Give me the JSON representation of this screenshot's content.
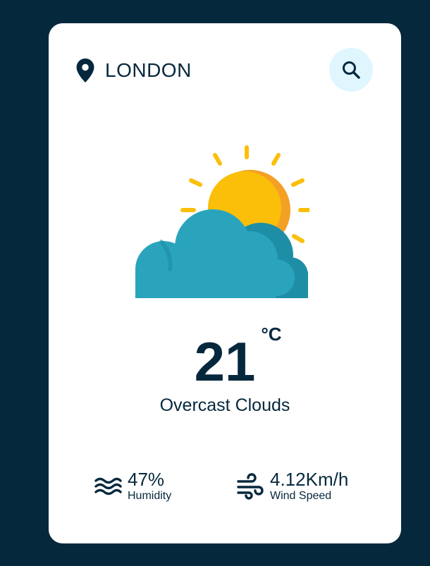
{
  "location": {
    "icon": "map-pin-icon",
    "city": "LONDON"
  },
  "search": {
    "icon": "search-icon"
  },
  "weather": {
    "icon": "sun-behind-cloud-icon",
    "temperature": "21",
    "unit": "°C",
    "description": "Overcast Clouds"
  },
  "details": {
    "humidity": {
      "icon": "waves-icon",
      "value": "47%",
      "label": "Humidity"
    },
    "wind": {
      "icon": "wind-icon",
      "value": "4.12Km/h",
      "label": "Wind Speed"
    }
  },
  "colors": {
    "background": "#06283d",
    "card": "#ffffff",
    "text": "#06283d",
    "search_bg": "#dff6ff",
    "sun": "#fbbf0a",
    "sun_shade": "#f4a024",
    "cloud": "#2aa4bd",
    "cloud_shade": "#1e8ea6"
  }
}
